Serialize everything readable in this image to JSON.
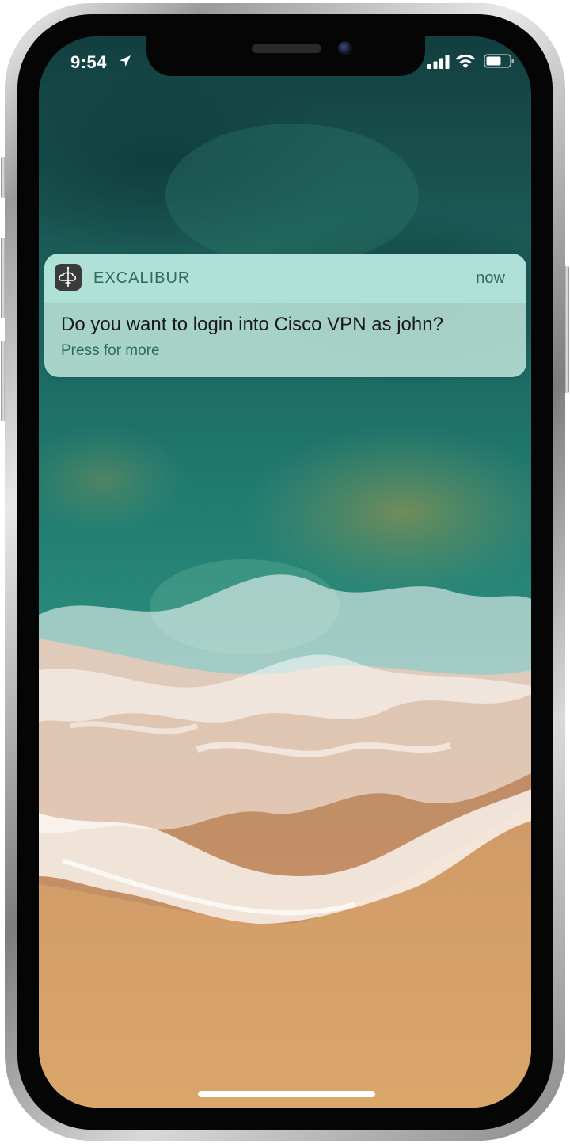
{
  "status_bar": {
    "time": "9:54",
    "location_icon": "location-arrow-icon",
    "signal_icon": "cellular-signal-icon",
    "wifi_icon": "wifi-icon",
    "battery_icon": "battery-icon"
  },
  "notification": {
    "app_icon": "excalibur-app-icon",
    "app_name": "EXCALIBUR",
    "time": "now",
    "title": "Do you want to login into Cisco VPN as john?",
    "more": "Press for more"
  },
  "colors": {
    "notification_accent": "#2e6d5e",
    "notification_background": "#bee4da",
    "sea": "#1f6f69",
    "sand": "#d9a066"
  }
}
